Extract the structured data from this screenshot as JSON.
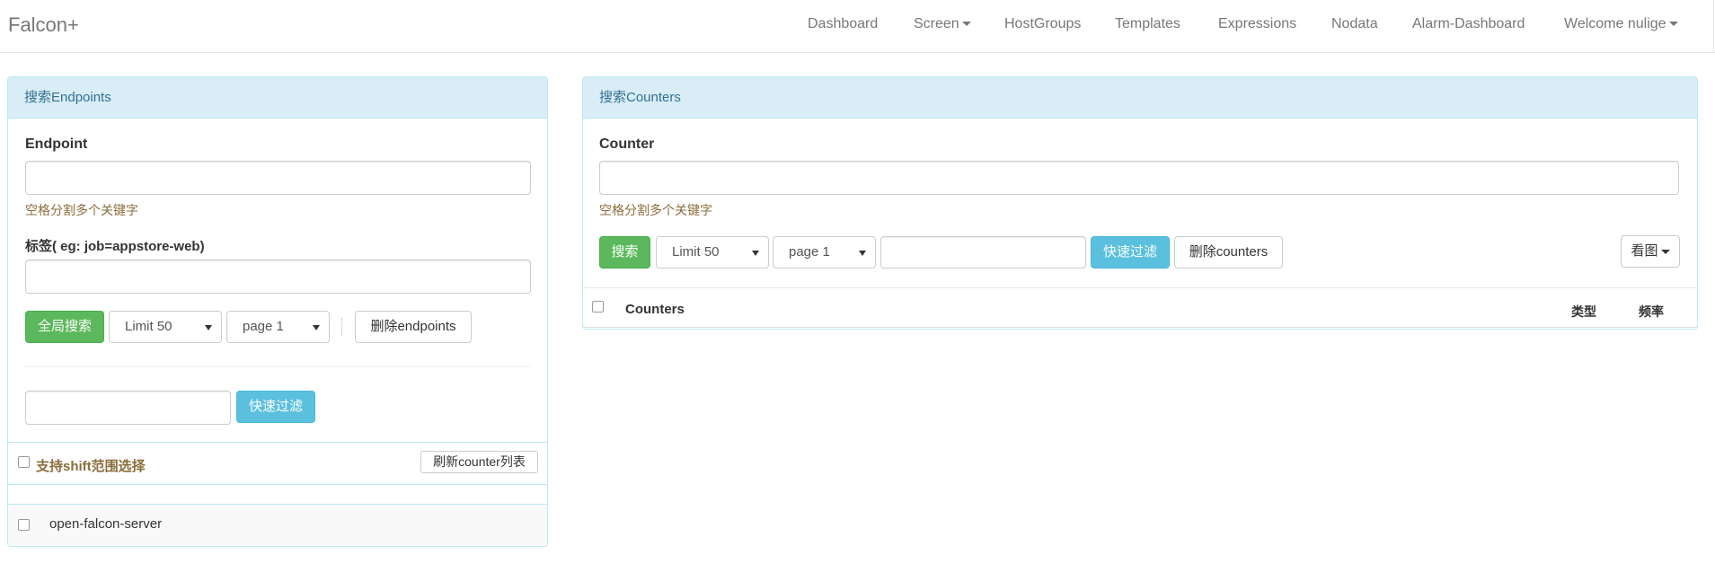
{
  "navbar": {
    "brand": "Falcon+",
    "items": [
      {
        "label": "Dashboard"
      },
      {
        "label": "Screen"
      },
      {
        "label": "HostGroups"
      },
      {
        "label": "Templates"
      },
      {
        "label": "Expressions"
      },
      {
        "label": "Nodata"
      },
      {
        "label": "Alarm-Dashboard"
      },
      {
        "label": "Welcome nulige"
      }
    ]
  },
  "endpoints_panel": {
    "heading": "搜索Endpoints",
    "endpoint_label": "Endpoint",
    "endpoint_value": "",
    "endpoint_help": "空格分割多个关键字",
    "tag_label": "标签( eg: job=appstore-web)",
    "tag_value": "",
    "search_button": "全局搜索",
    "limit_select": "Limit 50",
    "page_select": "page 1",
    "delete_button": "删除endpoints",
    "filter_value": "",
    "filter_button": "快速过滤",
    "shift_select_label": "支持shift范围选择",
    "refresh_button": "刷新counter列表",
    "results": [
      {
        "name": "open-falcon-server"
      }
    ]
  },
  "counters_panel": {
    "heading": "搜索Counters",
    "counter_label": "Counter",
    "counter_value": "",
    "counter_help": "空格分割多个关键字",
    "search_button": "搜索",
    "limit_select": "Limit 50",
    "page_select": "page 1",
    "filter_value": "",
    "filter_button": "快速过滤",
    "delete_button": "删除counters",
    "view_button": "看图",
    "table_headers": {
      "counters": "Counters",
      "type": "类型",
      "freq": "频率"
    }
  },
  "colors": {
    "panel_heading_bg": "#d9edf7",
    "panel_border": "#bce8f1",
    "success": "#5cb85c",
    "info": "#5bc0de",
    "help_text": "#8a6d3b"
  }
}
